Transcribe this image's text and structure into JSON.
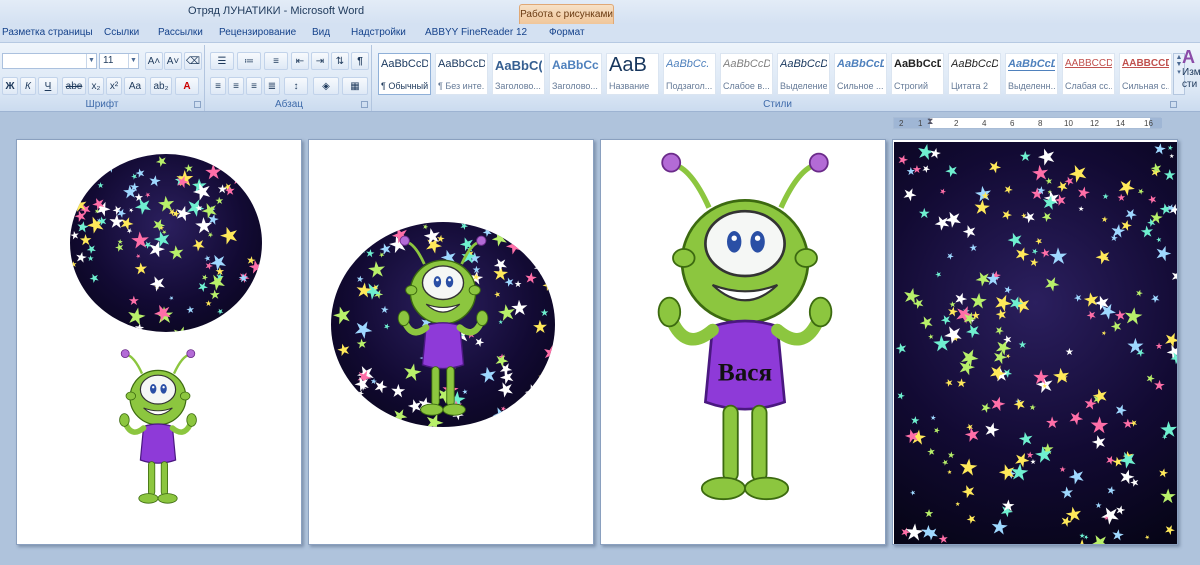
{
  "window": {
    "title": "Отряд ЛУНАТИКИ - Microsoft Word",
    "context_tab": "Работа с рисунками"
  },
  "tabs": [
    {
      "label": "Разметка страницы"
    },
    {
      "label": "Ссылки"
    },
    {
      "label": "Рассылки"
    },
    {
      "label": "Рецензирование"
    },
    {
      "label": "Вид"
    },
    {
      "label": "Надстройки"
    },
    {
      "label": "ABBYY FineReader 12"
    },
    {
      "label": "Формат"
    }
  ],
  "ribbon": {
    "font_group": {
      "label": "Шрифт",
      "font_name": "",
      "font_size": "11",
      "grow": "A˄",
      "shrink": "A˅",
      "bold": "Ж",
      "italic": "К",
      "underline": "Ч",
      "strike": "abe",
      "subscript": "x₂",
      "superscript": "x²",
      "case": "Aa",
      "highlight": "ab₂",
      "font_color": "A"
    },
    "paragraph_group": {
      "label": "Абзац"
    },
    "styles_group": {
      "label": "Стили",
      "items": [
        {
          "sample": "AaBbCcDc",
          "name": "¶ Обычный"
        },
        {
          "sample": "AaBbCcDc",
          "name": "¶ Без инте..."
        },
        {
          "sample": "AaBbC(",
          "name": "Заголово..."
        },
        {
          "sample": "AaBbCc",
          "name": "Заголово..."
        },
        {
          "sample": "AaB",
          "name": "Название"
        },
        {
          "sample": "AaBbCc.",
          "name": "Подзагол..."
        },
        {
          "sample": "AaBbCcDt",
          "name": "Слабое в..."
        },
        {
          "sample": "AaBbCcDt",
          "name": "Выделение"
        },
        {
          "sample": "AaBbCcDt",
          "name": "Сильное ..."
        },
        {
          "sample": "AaBbCcDt",
          "name": "Строгий"
        },
        {
          "sample": "AaBbCcDt",
          "name": "Цитата 2"
        },
        {
          "sample": "AaBbCcDt",
          "name": "Выделенн..."
        },
        {
          "sample": "AABBCCDE",
          "name": "Слабая сс..."
        },
        {
          "sample": "AABBCCDE",
          "name": "Сильная с..."
        }
      ],
      "change_styles": "Изм\nсти"
    }
  },
  "ruler": {
    "ticks": [
      "2",
      "1",
      "2",
      "4",
      "6",
      "8",
      "10",
      "12",
      "14",
      "16"
    ]
  },
  "pages": [
    {
      "name": "page-1"
    },
    {
      "name": "page-2"
    },
    {
      "name": "page-3",
      "caption": "Вася"
    },
    {
      "name": "page-4"
    }
  ],
  "colors": {
    "alien_green": "#8cc63f",
    "shirt_purple": "#8e3ad8",
    "space": "#120a33",
    "star_palette": [
      "#ffe95a",
      "#6ff0d0",
      "#ff6fa8",
      "#b8f06a",
      "#ffffff",
      "#9fd8ff"
    ]
  }
}
